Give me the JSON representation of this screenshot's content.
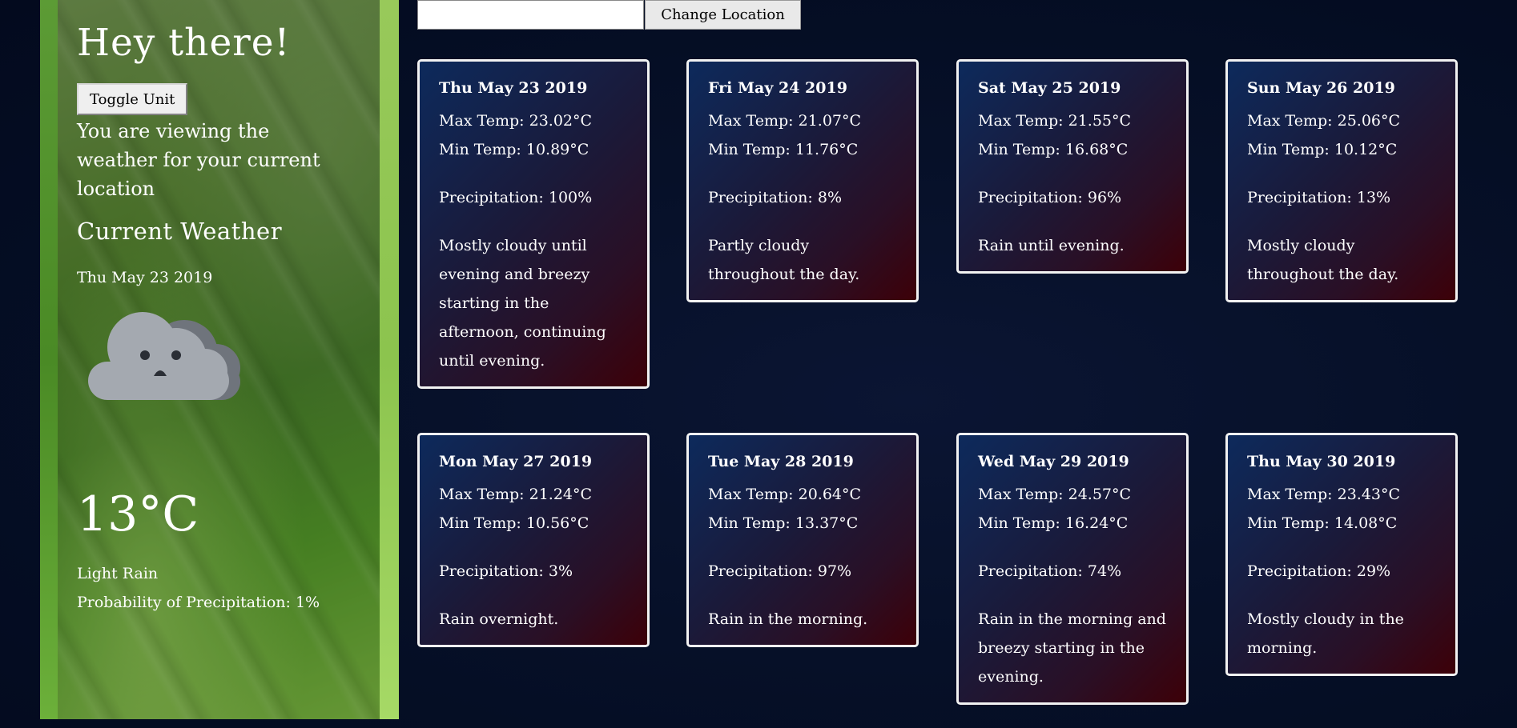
{
  "sidebar": {
    "greeting": "Hey there!",
    "toggle_label": "Toggle Unit",
    "location_note": "You are viewing the weather for your current location",
    "current_title": "Current Weather",
    "current_date": "Thu May 23 2019",
    "icon": "cloud-sad-face-icon",
    "temperature": "13°C",
    "summary": "Light Rain",
    "precipitation": "Probability of Precipitation: 1%"
  },
  "location": {
    "input_value": "",
    "input_placeholder": "",
    "button_label": "Change Location"
  },
  "colors": {
    "card_border": "#f2f2f2",
    "card_top_left": "#0d2a5c",
    "card_bottom_right": "#3d0008",
    "page_background": "#061028"
  },
  "forecast": [
    {
      "day": "Thu May 23 2019",
      "max": "Max Temp: 23.02°C",
      "min": "Min Temp: 10.89°C",
      "precip": "Precipitation: 100%",
      "desc": "Mostly cloudy until evening and breezy starting in the afternoon, continuing until evening."
    },
    {
      "day": "Fri May 24 2019",
      "max": "Max Temp: 21.07°C",
      "min": "Min Temp: 11.76°C",
      "precip": "Precipitation: 8%",
      "desc": "Partly cloudy throughout the day."
    },
    {
      "day": "Sat May 25 2019",
      "max": "Max Temp: 21.55°C",
      "min": "Min Temp: 16.68°C",
      "precip": "Precipitation: 96%",
      "desc": "Rain until evening."
    },
    {
      "day": "Sun May 26 2019",
      "max": "Max Temp: 25.06°C",
      "min": "Min Temp: 10.12°C",
      "precip": "Precipitation: 13%",
      "desc": "Mostly cloudy throughout the day."
    },
    {
      "day": "Mon May 27 2019",
      "max": "Max Temp: 21.24°C",
      "min": "Min Temp: 10.56°C",
      "precip": "Precipitation: 3%",
      "desc": "Rain overnight."
    },
    {
      "day": "Tue May 28 2019",
      "max": "Max Temp: 20.64°C",
      "min": "Min Temp: 13.37°C",
      "precip": "Precipitation: 97%",
      "desc": "Rain in the morning."
    },
    {
      "day": "Wed May 29 2019",
      "max": "Max Temp: 24.57°C",
      "min": "Min Temp: 16.24°C",
      "precip": "Precipitation: 74%",
      "desc": "Rain in the morning and breezy starting in the evening."
    },
    {
      "day": "Thu May 30 2019",
      "max": "Max Temp: 23.43°C",
      "min": "Min Temp: 14.08°C",
      "precip": "Precipitation: 29%",
      "desc": "Mostly cloudy in the morning."
    }
  ]
}
